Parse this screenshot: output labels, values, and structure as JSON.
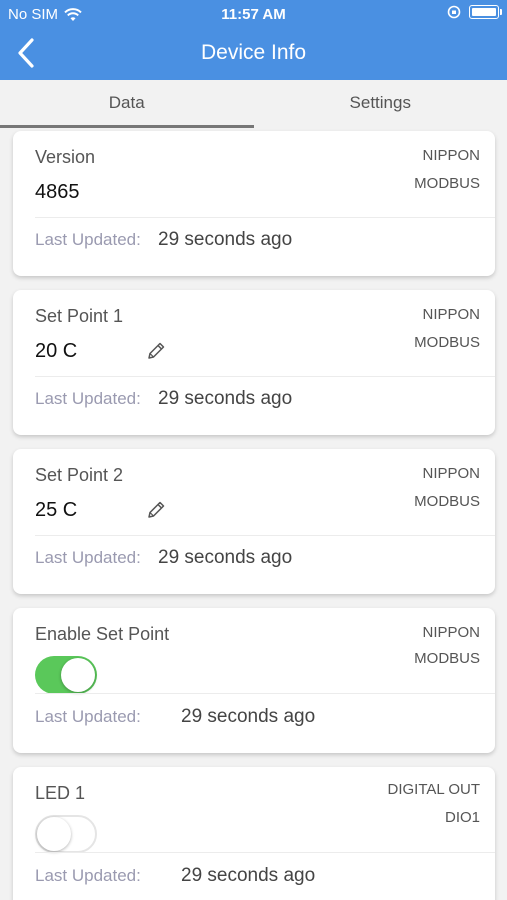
{
  "status_bar": {
    "carrier": "No SIM",
    "time": "11:57 AM",
    "icons": [
      "wifi-icon",
      "orientation-lock-icon",
      "battery-icon"
    ]
  },
  "nav": {
    "title": "Device Info",
    "back_icon": "chevron-left-icon"
  },
  "tabs": [
    {
      "label": "Data",
      "active": true
    },
    {
      "label": "Settings",
      "active": false
    }
  ],
  "cards": [
    {
      "name": "Version",
      "value": "4865",
      "source1": "NIPPON",
      "source2": "MODBUS",
      "updated_label": "Last Updated:",
      "updated_value": "29 seconds ago",
      "editable": false
    },
    {
      "name": "Set Point 1",
      "value": "20 C",
      "source1": "NIPPON",
      "source2": "MODBUS",
      "updated_label": "Last Updated:",
      "updated_value": "29 seconds ago",
      "editable": true
    },
    {
      "name": "Set Point 2",
      "value": "25 C",
      "source1": "NIPPON",
      "source2": "MODBUS",
      "updated_label": "Last Updated:",
      "updated_value": "29 seconds ago",
      "editable": true
    },
    {
      "name": "Enable Set Point",
      "toggle": true,
      "source1": "NIPPON",
      "source2": "MODBUS",
      "updated_label": "Last Updated:",
      "updated_value": "29 seconds ago"
    },
    {
      "name": "LED 1",
      "toggle": false,
      "source1": "DIGITAL OUT",
      "source2": "DIO1",
      "updated_label": "Last Updated:",
      "updated_value": "29 seconds ago"
    }
  ],
  "colors": {
    "header": "#4a90e2",
    "toggle_on": "#5ac85a",
    "label_muted": "#9a9ab0"
  }
}
